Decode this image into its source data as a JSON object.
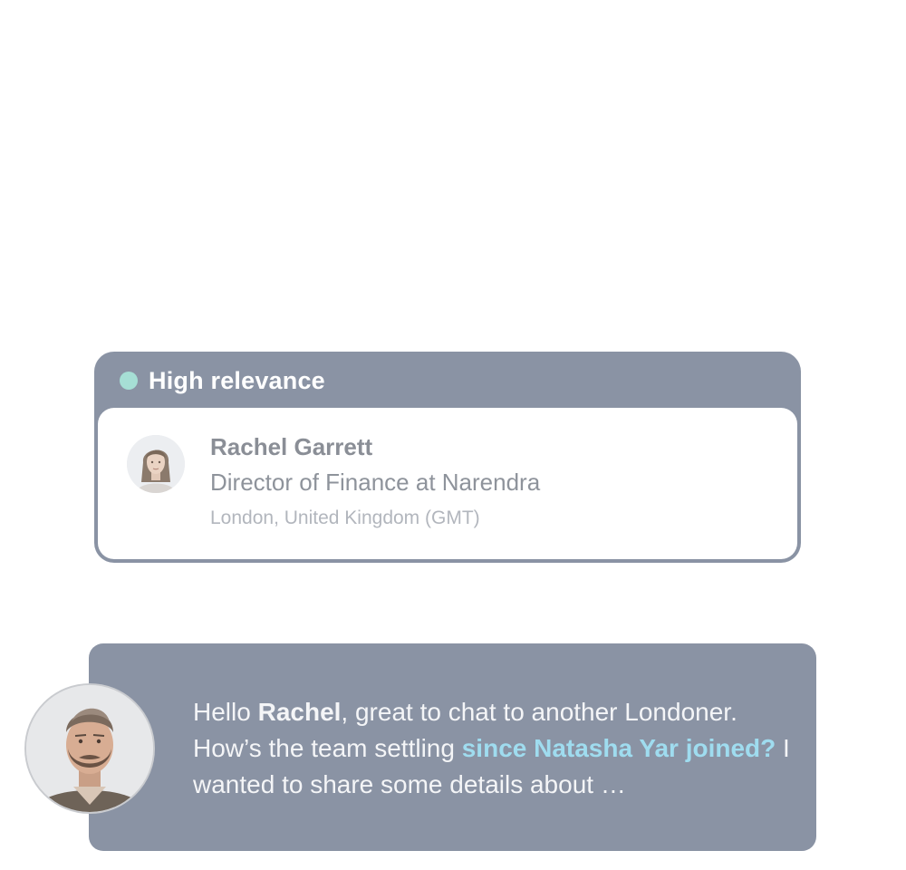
{
  "relevance": {
    "label": "High relevance",
    "dot_color": "#a6dfd5"
  },
  "profile": {
    "name": "Rachel Garrett",
    "role": "Director of Finance at Narendra",
    "location": "London, United Kingdom (GMT)",
    "avatar_icon": "woman-portrait"
  },
  "message": {
    "greeting": "Hello ",
    "recipient": "Rachel",
    "line1_rest": ", great to chat to another Londoner.",
    "line2_start": "How’s the team settling ",
    "highlight": "since Natasha Yar joined?",
    "line3_rest": " I wanted to share some details about …",
    "highlight_color": "#9fdcef",
    "sender_avatar_icon": "man-portrait"
  },
  "colors": {
    "card_background": "#8a93a4",
    "panel_background": "#ffffff"
  }
}
